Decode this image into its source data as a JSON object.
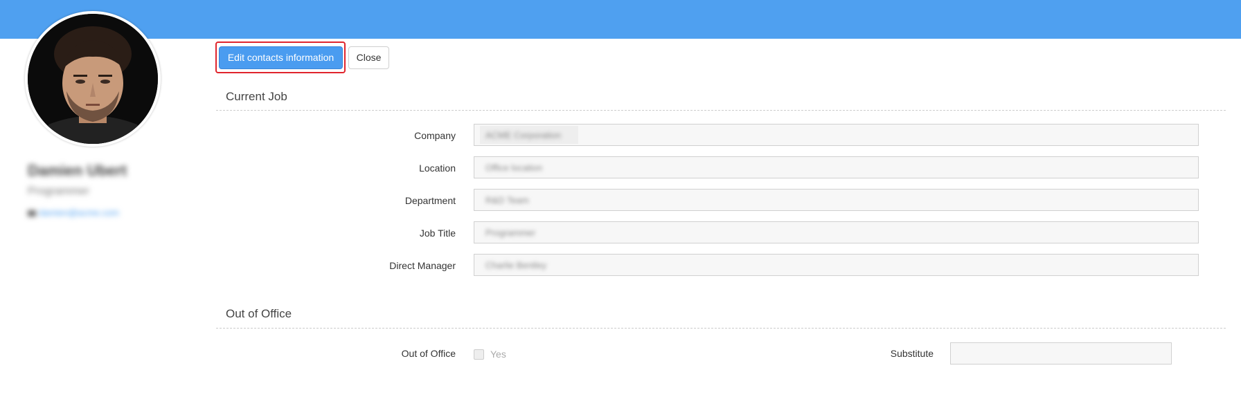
{
  "buttons": {
    "edit_label": "Edit contacts information",
    "close_label": "Close"
  },
  "profile": {
    "name": "Damien Ubert",
    "title": "Programmer",
    "email": "damien@acme.com"
  },
  "current_job": {
    "heading": "Current Job",
    "fields": [
      {
        "label": "Company",
        "value": "ACME Corporation"
      },
      {
        "label": "Location",
        "value": "Office location"
      },
      {
        "label": "Department",
        "value": "R&D Team"
      },
      {
        "label": "Job Title",
        "value": "Programmer"
      },
      {
        "label": "Direct Manager",
        "value": "Charlie Bentley"
      }
    ]
  },
  "out_of_office": {
    "heading": "Out of Office",
    "label": "Out of Office",
    "checkbox_label": "Yes",
    "substitute_label": "Substitute",
    "substitute_value": ""
  },
  "colors": {
    "topbar": "#4fa0f0",
    "primary_button": "#4a9cf0",
    "highlight_border": "#e0242c"
  },
  "icons": {
    "avatar": "user-photo",
    "email": "mail-icon"
  }
}
